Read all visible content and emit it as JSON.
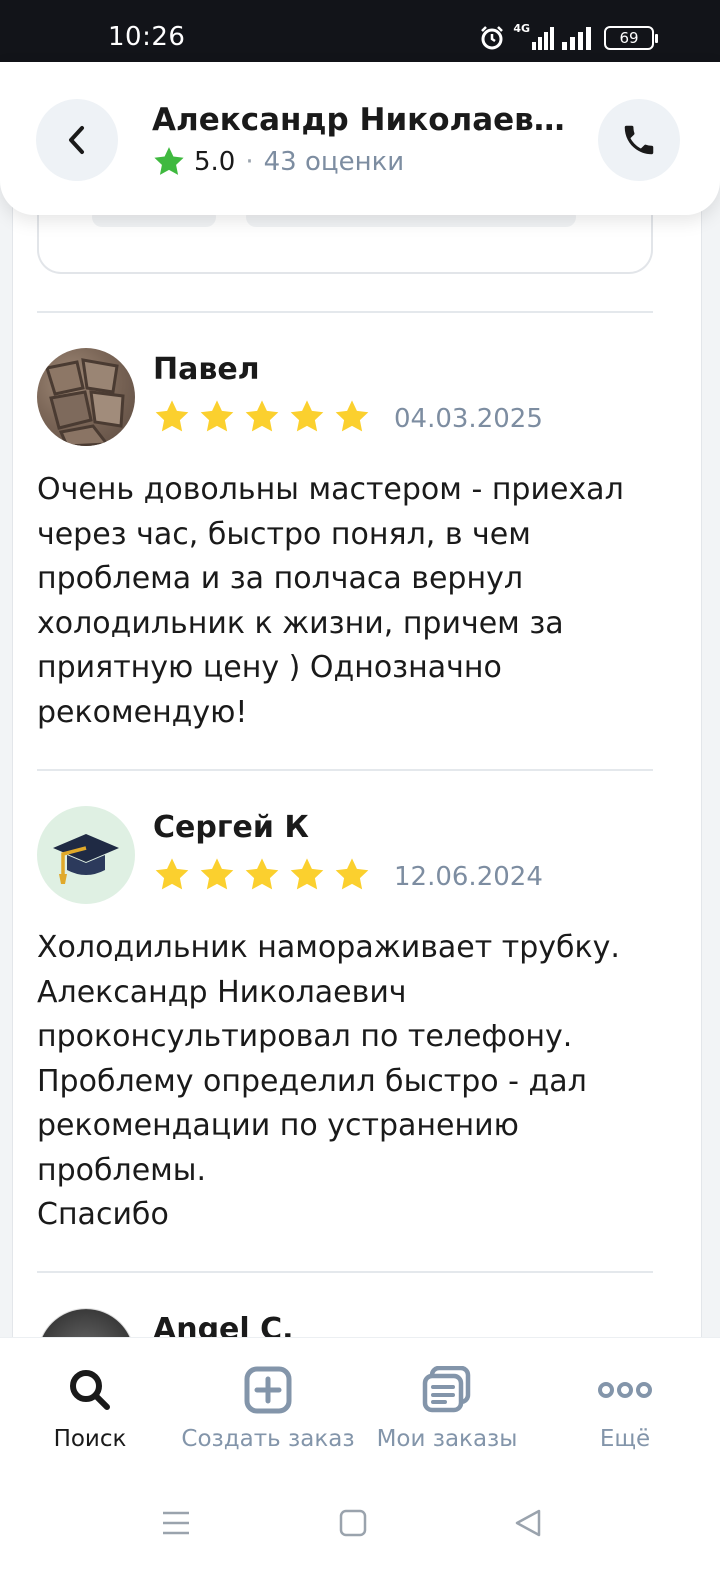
{
  "status_bar": {
    "time": "10:26",
    "network": "4G",
    "battery": "69"
  },
  "header": {
    "title": "Александр Николаевич...",
    "rating": "5.0",
    "separator": "·",
    "ratings_count": "43 оценки"
  },
  "reviews": [
    {
      "name": "Павел",
      "date": "04.03.2025",
      "stars": 5,
      "text": "Очень довольны мастером - приехал через час, быстро понял, в чем проблема и за полчаса вернул холодильник к жизни, причем за приятную цену ) Однозначно рекомендую!"
    },
    {
      "name": "Сергей К",
      "date": "12.06.2024",
      "stars": 5,
      "text": "Холодильник намораживает трубку. Александр Николаевич проконсультировал по телефону. Проблему определил быстро - дал рекомендации по устранению проблемы.\nСпасибо"
    },
    {
      "name": "Angel C."
    }
  ],
  "bottom_nav": [
    {
      "label": "Поиск",
      "icon": "search-icon",
      "active": true
    },
    {
      "label": "Создать заказ",
      "icon": "plus-square-icon",
      "active": false
    },
    {
      "label": "Мои заказы",
      "icon": "orders-icon",
      "active": false
    },
    {
      "label": "Ещё",
      "icon": "more-icon",
      "active": false
    }
  ],
  "colors": {
    "star": "#fbd02e",
    "accent_star": "#3fb93f",
    "muted": "#7d8da1"
  }
}
